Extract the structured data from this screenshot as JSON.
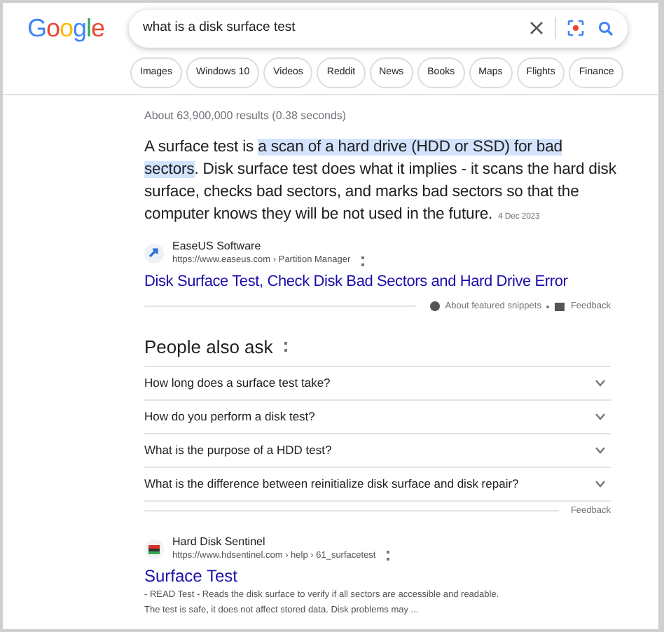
{
  "header": {
    "logo": "Google",
    "query": "what is a disk surface test"
  },
  "chips": [
    {
      "label": "Images"
    },
    {
      "label": "Windows 10"
    },
    {
      "label": "Videos"
    },
    {
      "label": "Reddit"
    },
    {
      "label": "News"
    },
    {
      "label": "Books"
    },
    {
      "label": "Maps"
    },
    {
      "label": "Flights"
    },
    {
      "label": "Finance"
    }
  ],
  "result_stats": "About 63,900,000 results (0.38 seconds)",
  "featured_snippet": {
    "text_before": "A surface test is ",
    "highlight": "a scan of a hard drive (HDD or SSD) for bad sectors",
    "text_after": ". Disk surface test does what it implies - it scans the hard disk surface, checks bad sectors, and marks bad sectors so that the computer knows they will be not used in the future.",
    "date": "4 Dec 2023",
    "source_name": "EaseUS Software",
    "source_url": "https://www.easeus.com › Partition Manager",
    "title": "Disk Surface Test, Check Disk Bad Sectors and Hard Drive Error",
    "about": "About featured snippets",
    "feedback": "Feedback"
  },
  "people_also_ask": {
    "heading": "People also ask",
    "questions": [
      {
        "text": "How long does a surface test take?",
        "expanded": false
      },
      {
        "text": "How do you perform a disk test?",
        "expanded": false
      },
      {
        "text": "What is the purpose of a HDD test?",
        "expanded": false
      },
      {
        "text": "What is the difference between reinitialize disk surface and disk repair?",
        "expanded": false
      }
    ],
    "feedback": "Feedback"
  },
  "result": {
    "source_name": "Hard Disk Sentinel",
    "source_url": "https://www.hdsentinel.com › help › 61_surfacetest",
    "title": "Surface Test",
    "snippet_lines": [
      "- READ Test - Reads the disk surface to verify if all sectors are accessible and readable.",
      "The test is safe, it does not affect stored data. Disk problems may ..."
    ]
  }
}
